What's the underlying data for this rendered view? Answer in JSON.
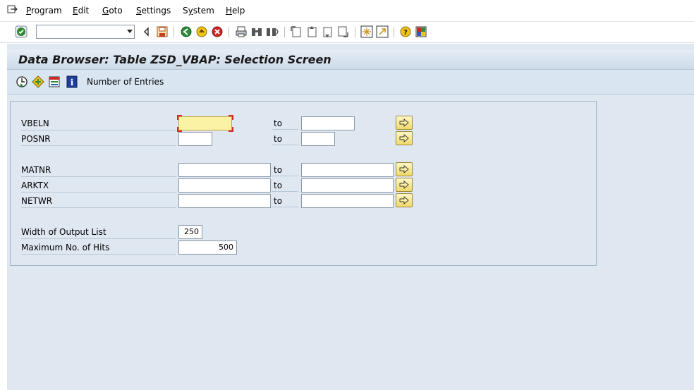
{
  "menubar": {
    "items": [
      {
        "pre": "",
        "u": "P",
        "post": "rogram"
      },
      {
        "pre": "",
        "u": "E",
        "post": "dit"
      },
      {
        "pre": "",
        "u": "G",
        "post": "oto"
      },
      {
        "pre": "",
        "u": "S",
        "post": "ettings"
      },
      {
        "pre": "S",
        "u": "y",
        "post": "stem"
      },
      {
        "pre": "",
        "u": "H",
        "post": "elp"
      }
    ]
  },
  "toolbar": {
    "command_field_value": ""
  },
  "screen": {
    "title": "Data Browser: Table ZSD_VBAP: Selection Screen"
  },
  "app_toolbar": {
    "number_of_entries_label": "Number of Entries"
  },
  "selection": {
    "to_label": "to",
    "fields": [
      {
        "label": "VBELN",
        "low": "",
        "high": ""
      },
      {
        "label": "POSNR",
        "low": "",
        "high": ""
      },
      {
        "label": "MATNR",
        "low": "",
        "high": ""
      },
      {
        "label": "ARKTX",
        "low": "",
        "high": ""
      },
      {
        "label": "NETWR",
        "low": "",
        "high": ""
      }
    ],
    "width_label": "Width of Output List",
    "width_value": "250",
    "max_hits_label": "Maximum No. of Hits",
    "max_hits_value": "500"
  },
  "colors": {
    "background": "#dfe7f1",
    "title_bar": "#cddbe9",
    "focus_field": "#fbf3a3",
    "button_yellow": "#f1d96a"
  }
}
